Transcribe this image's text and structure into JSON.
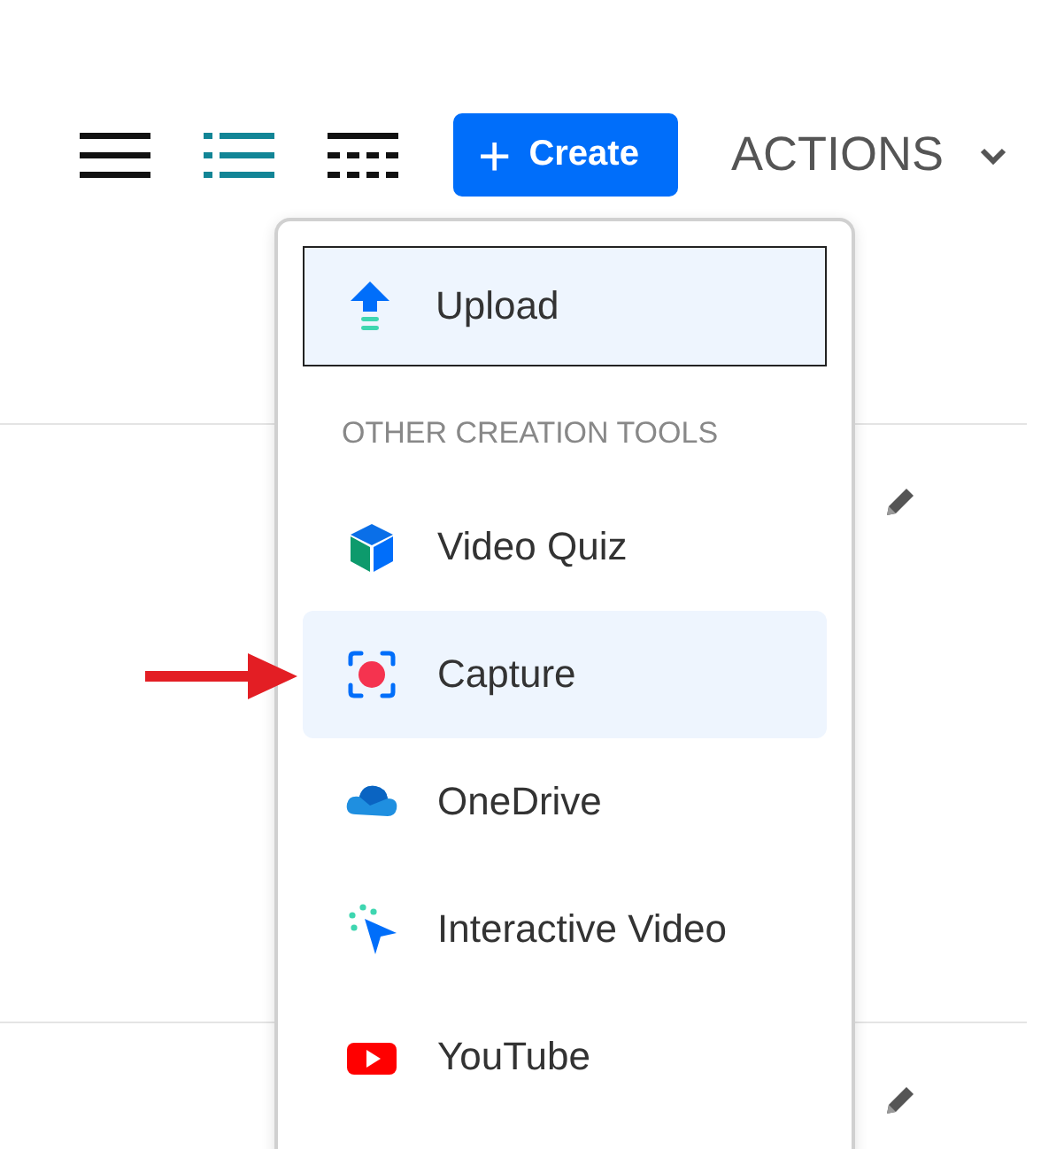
{
  "toolbar": {
    "view_modes": [
      {
        "kind": "list",
        "selected": false
      },
      {
        "kind": "detailed",
        "selected": true
      },
      {
        "kind": "grid",
        "selected": false
      }
    ],
    "create_button": {
      "icon": "+",
      "label": "Create"
    },
    "actions": {
      "label": "ACTIONS"
    }
  },
  "rows": [
    {
      "editable": true
    },
    {
      "editable": true
    }
  ],
  "create_menu": {
    "items": [
      {
        "kind": "upload",
        "label": "Upload",
        "focused": true
      }
    ],
    "section_heading": "OTHER CREATION TOOLS",
    "tools": [
      {
        "kind": "quiz",
        "label": "Video Quiz",
        "selected": false
      },
      {
        "kind": "capture",
        "label": "Capture",
        "selected": true
      },
      {
        "kind": "onedrive",
        "label": "OneDrive",
        "selected": false
      },
      {
        "kind": "interactive",
        "label": "Interactive Video",
        "selected": false
      },
      {
        "kind": "youtube",
        "label": "YouTube",
        "selected": false
      }
    ]
  },
  "annotation": {
    "kind": "arrow"
  }
}
